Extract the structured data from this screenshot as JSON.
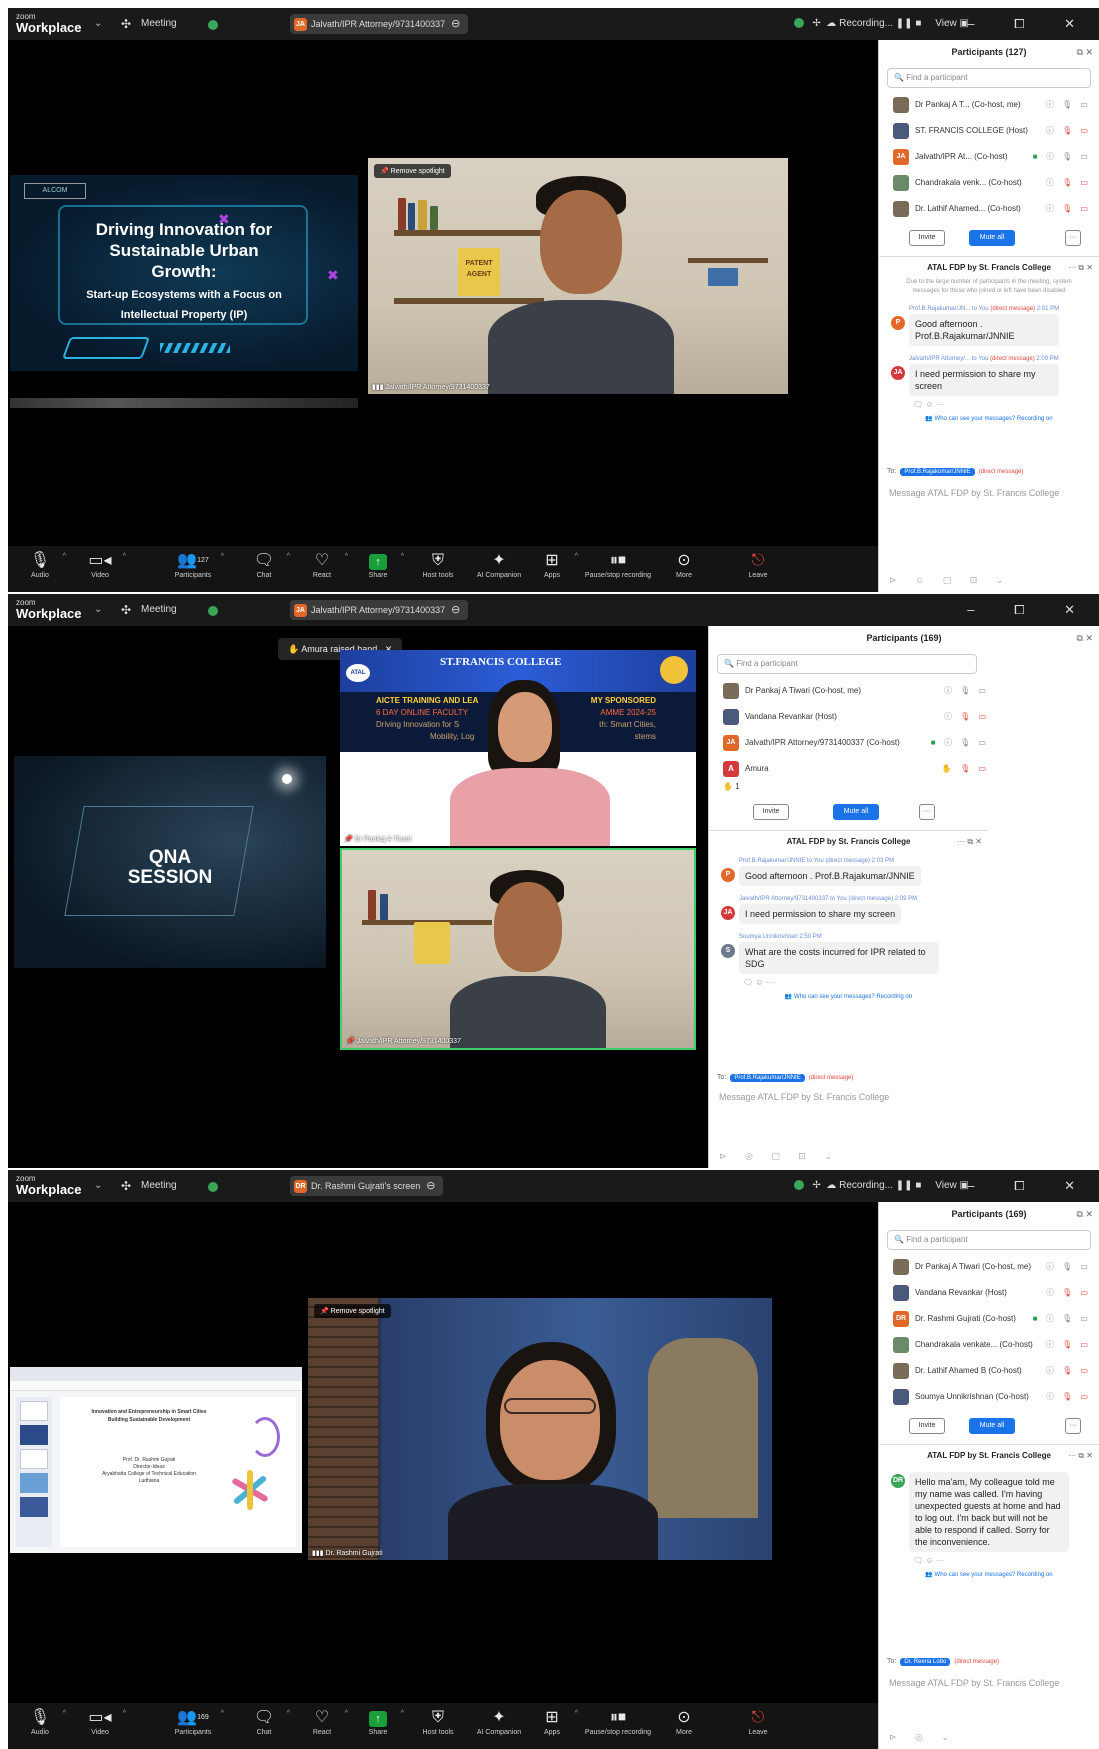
{
  "common": {
    "zoom_small": "zoom",
    "zoom_big": "Workplace",
    "meeting_label": "Meeting",
    "chevron": "⌄",
    "window_controls": "–  ⧠  ✕",
    "recording_label": "Recording...",
    "view_label": "View",
    "find_placeholder": "Find a participant",
    "invite_label": "Invite",
    "mute_all_label": "Mute all",
    "more_dots": "···",
    "chat_title": "ATAL FDP by St. Francis College",
    "who_can_see": "Who can see your messages? Recording on",
    "to_label": "To:",
    "direct_message": "(direct message)",
    "message_placeholder": "Message ATAL FDP by St. Francis College",
    "toolbar": {
      "audio": "Audio",
      "video": "Video",
      "participants": "Participants",
      "chat": "Chat",
      "react": "React",
      "share": "Share",
      "host_tools": "Host tools",
      "ai_companion": "AI Companion",
      "apps": "Apps",
      "pause_recording": "Pause/stop recording",
      "more": "More",
      "leave": "Leave"
    }
  },
  "panel1": {
    "share_title": "Jalvath/IPR Attorney/9731400337",
    "participants_header": "Participants (127)",
    "participant_count": "127",
    "participants": [
      {
        "name": "Dr Pankaj A T... (Co-host, me)"
      },
      {
        "name": "ST. FRANCIS COLLEGE (Host)"
      },
      {
        "name": "Jalvath/IPR At... (Co-host)",
        "initials": "JA"
      },
      {
        "name": "Chandrakala venk... (Co-host)"
      },
      {
        "name": "Dr. Lathif Ahamed... (Co-host)"
      }
    ],
    "system_msg": "Due to the large number of participants in the meeting, system messages for those who joined or left have been disabled",
    "messages": [
      {
        "from": "Prof.B.Rajakumar/JN... to You",
        "time": "2:01 PM",
        "text": "Good afternoon . Prof.B.Rajakumar/JNNIE",
        "initial": "P"
      },
      {
        "from": "Jalvath/IPR Attorney/... to You",
        "time": "2:09 PM",
        "text": "I need permission to share my screen",
        "initial": "JA"
      }
    ],
    "to_recipient": "Prof.B.Rajakumar/JNNIE",
    "slide": {
      "logo": "ALCOM",
      "line1": "Driving Innovation for",
      "line2": "Sustainable Urban",
      "line3": "Growth:",
      "line4": "Start-up Ecosystems with a Focus on",
      "line5": "Intellectual Property (IP)"
    },
    "spotlight": "Remove spotlight",
    "video_name": "Jalvath/IPR Attorney/9731400337",
    "poster_text": "PATENT AGENT"
  },
  "panel2": {
    "share_title": "Jalvath/IPR Attorney/9731400337",
    "raised_hand_toast": "Amura raised hand",
    "participants_header": "Participants (169)",
    "participant_count": "169",
    "participants": [
      {
        "name": "Dr Pankaj A Tiwari (Co-host, me)"
      },
      {
        "name": "Vandana Revankar (Host)"
      },
      {
        "name": "Jalvath/IPR Attorney/9731400337 (Co-host)",
        "initials": "JA"
      },
      {
        "name": "Amura",
        "initials": "A"
      }
    ],
    "raised_count": "1",
    "messages": [
      {
        "from": "Prof.B.Rajakumar/JNNIE to You (direct message)",
        "time": "2:03 PM",
        "text": "Good afternoon . Prof.B.Rajakumar/JNNIE",
        "initial": "P"
      },
      {
        "from": "Jalvath/IPR Attorney/9731400337 to You (direct message)",
        "time": "2:09 PM",
        "text": "I need permission to share my screen",
        "initial": "JA"
      },
      {
        "from": "Soumya Unnikrishnan",
        "time": "2:50 PM",
        "text": "What are the costs incurred for IPR related to SDG",
        "initial": "S"
      }
    ],
    "to_recipient": "Prof.B.Rajakumar/JNNIE",
    "slide_text_line1": "QNA",
    "slide_text_line2": "SESSION",
    "banner": {
      "college": "ST.FRANCIS COLLEGE",
      "line1": "AICTE TRAINING AND LEA",
      "line1b": "MY SPONSORED",
      "line2": "6 DAY ONLINE FACULTY",
      "line2b": "AMME 2024-25",
      "line3": "Driving Innovation for S",
      "line3b": "th: Smart Cities,",
      "line4": "Mobility, Log",
      "line4b": "stems",
      "atal": "ATAL"
    },
    "video1_name": "Dr Pankaj A Tiwari",
    "video2_name": "Jalvath/IPR Attorney/9731400337"
  },
  "panel3": {
    "share_title": "Dr. Rashmi Gujrati's screen",
    "share_initials": "DR",
    "participants_header": "Participants (169)",
    "participant_count": "169",
    "participants": [
      {
        "name": "Dr Pankaj A Tiwari (Co-host, me)"
      },
      {
        "name": "Vandana Revankar (Host)"
      },
      {
        "name": "Dr. Rashmi Gujrati (Co-host)",
        "initials": "DR"
      },
      {
        "name": "Chandrakala venkate... (Co-host)"
      },
      {
        "name": "Dr. Lathif Ahamed B (Co-host)"
      },
      {
        "name": "Soumya Unnikrishnan (Co-host)"
      }
    ],
    "messages": [
      {
        "text": "Hello ma'am, My colleague told me my name was called. I'm having unexpected guests at home and had to log out. I'm back but will not be able to respond if called. Sorry for the inconvenience.",
        "initial": "DR"
      }
    ],
    "to_recipient": "Dr. Reena Lobo",
    "spotlight": "Remove spotlight",
    "video_name": "Dr. Rashmi Gujrati",
    "doc": {
      "title1": "Innovation and Entrepreneurship in Smart Cities",
      "title2": "Building Sustainable Development",
      "author1": "Prof. Dr. Rashmi Gujrati",
      "author2": "Director-Ideas",
      "author3": "Aryabhatta College of Technical Education",
      "author4": "Ludhiana"
    }
  }
}
